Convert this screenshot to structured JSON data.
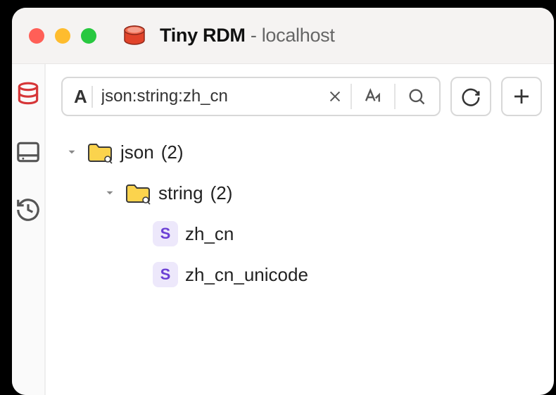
{
  "window": {
    "app_name": "Tiny RDM",
    "subtitle": "- localhost"
  },
  "sidebar": {
    "items": [
      {
        "name": "database",
        "active": true
      },
      {
        "name": "storage",
        "active": false
      },
      {
        "name": "history",
        "active": false
      }
    ]
  },
  "search": {
    "prefix": "A",
    "value": "json:string:zh_cn",
    "placeholder": ""
  },
  "tree": {
    "nodes": [
      {
        "level": 0,
        "type": "folder",
        "expanded": true,
        "label": "json",
        "count": "(2)"
      },
      {
        "level": 1,
        "type": "folder",
        "expanded": true,
        "label": "string",
        "count": "(2)"
      },
      {
        "level": 2,
        "type": "string",
        "label": "zh_cn"
      },
      {
        "level": 2,
        "type": "string",
        "label": "zh_cn_unicode"
      }
    ]
  },
  "badges": {
    "string": "S"
  }
}
